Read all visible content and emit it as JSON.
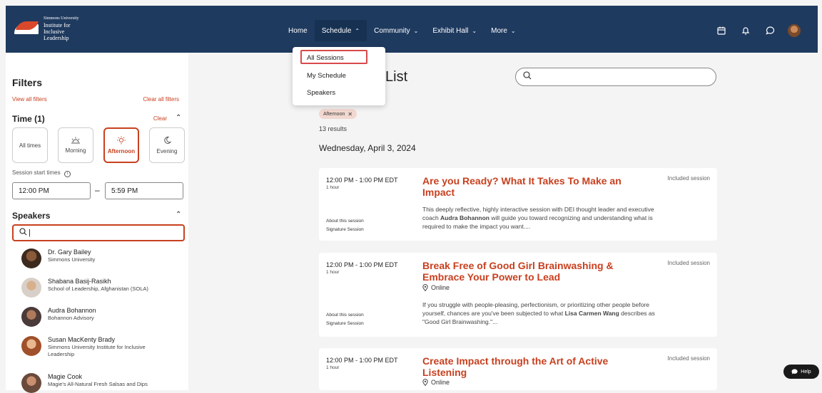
{
  "header": {
    "logo_line1": "Simmons University",
    "logo_line2": "Institute for",
    "logo_line3": "Inclusive Leadership",
    "nav": [
      "Home",
      "Schedule",
      "Community",
      "Exhibit Hall",
      "More"
    ],
    "icons": [
      "calendar-icon",
      "bell-icon",
      "chat-icon",
      "user-avatar"
    ]
  },
  "dropdown": {
    "items": [
      "All Sessions",
      "My Schedule",
      "Speakers"
    ]
  },
  "sidebar": {
    "title": "Filters",
    "view_all": "View all filters",
    "clear_all": "Clear all filters",
    "time_title": "Time (1)",
    "time_clear": "Clear",
    "tiles": [
      "All times",
      "Morning",
      "Afternoon",
      "Evening"
    ],
    "selected_tile": "Afternoon",
    "session_start_label": "Session start times",
    "start_time": "12:00 PM",
    "end_time": "5:59 PM",
    "speakers_title": "Speakers",
    "speaker_search_value": "",
    "speakers": [
      {
        "name": "Dr. Gary Bailey",
        "org": "Simmons University"
      },
      {
        "name": "Shabana Basij-Rasikh",
        "org": "School of Leadership, Afghanistan (SOLA)"
      },
      {
        "name": "Audra Bohannon",
        "org": "Bohannon Advisory"
      },
      {
        "name": "Susan MacKenty Brady",
        "org": "Simmons University Institute for Inclusive Leadership"
      },
      {
        "name": "Magie Cook",
        "org": "Magie's All-Natural Fresh Salsas and Dips"
      }
    ]
  },
  "main": {
    "title_fragment": "List",
    "search_value": "",
    "chip": "Afternoon",
    "results": "13 results",
    "date": "Wednesday, April 3, 2024",
    "cards": [
      {
        "time": "12:00 PM - 1:00 PM EDT",
        "duration": "1 hour",
        "title": "Are you Ready? What It Takes To Make an Impact",
        "badge": "Included session",
        "location": "",
        "desc_pre": "This deeply reflective, highly interactive session with DEI thought leader and executive coach ",
        "desc_bold": "Audra Bohannon",
        "desc_post": " will guide you toward recognizing and understanding what is required to make the impact you want....",
        "about": "About this session",
        "type": "Signature Session"
      },
      {
        "time": "12:00 PM - 1:00 PM EDT",
        "duration": "1 hour",
        "title": "Break Free of Good Girl Brainwashing & Embrace Your Power to Lead",
        "badge": "Included session",
        "location": "Online",
        "desc_pre": "If you struggle with people-pleasing, perfectionism, or prioritizing other people before yourself, chances are you've been subjected to what ",
        "desc_bold": "Lisa Carmen Wang",
        "desc_post": " describes as \"Good Girl Brainwashing.\"...",
        "about": "About this session",
        "type": "Signature Session"
      },
      {
        "time": "12:00 PM - 1:00 PM EDT",
        "duration": "1 hour",
        "title": "Create Impact through the Art of Active Listening",
        "badge": "Included session",
        "location": "Online"
      }
    ]
  },
  "help_label": "Help",
  "colors": {
    "brand_navy": "#1f3a5f",
    "accent": "#c8401f",
    "chip_bg": "#f2d8d0"
  }
}
